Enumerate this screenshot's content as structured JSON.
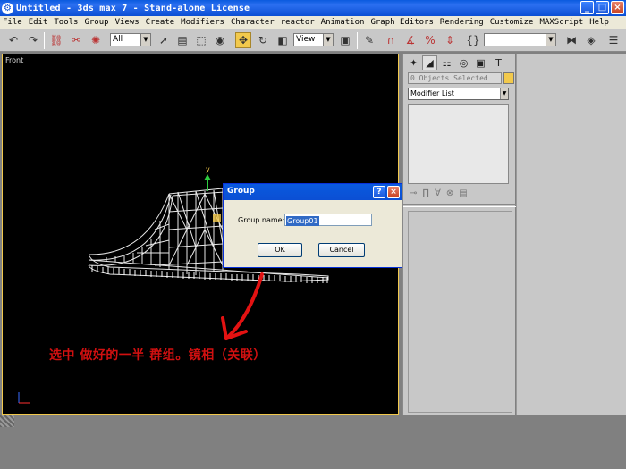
{
  "window": {
    "title": "Untitled  - 3ds max 7  - Stand-alone License",
    "app_icon": "3ds-max-icon",
    "buttons": [
      "minimize",
      "maximize",
      "close"
    ]
  },
  "menu": [
    "File",
    "Edit",
    "Tools",
    "Group",
    "Views",
    "Create",
    "Modifiers",
    "Character",
    "reactor",
    "Animation",
    "Graph Editors",
    "Rendering",
    "Customize",
    "MAXScript",
    "Help"
  ],
  "toolbar": {
    "selection_filter": "All",
    "reference_coord": "View",
    "named_selection": "",
    "active_tool": "select-and-move",
    "accent": "#f2c94c"
  },
  "viewport": {
    "label": "Front",
    "axis_y": "y",
    "border_color": "#f2c94c"
  },
  "command_panel": {
    "object_status": "0 Objects Selected",
    "modifier_list": "Modifier List"
  },
  "dialog": {
    "title": "Group",
    "help_label": "?",
    "close_label": "×",
    "field_label": "Group name:",
    "field_value": "Group01",
    "ok_label": "OK",
    "cancel_label": "Cancel"
  },
  "annotation": {
    "text": "选中 做好的一半  群组。镜相（关联）",
    "color": "#d11010"
  }
}
